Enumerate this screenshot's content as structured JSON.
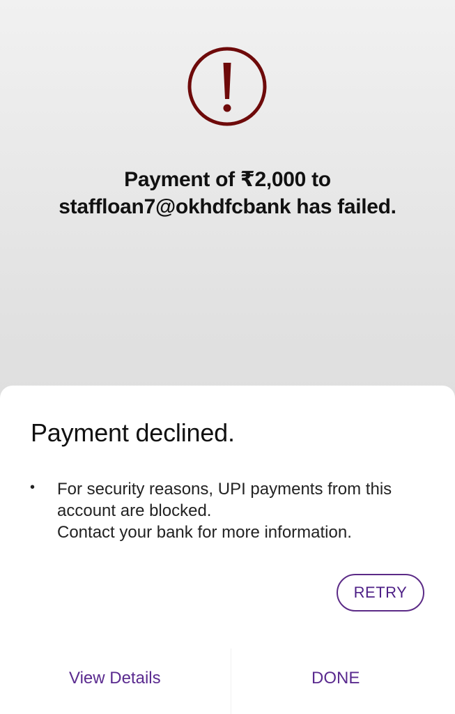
{
  "status": {
    "icon": "exclamation-circle-icon",
    "icon_color": "#6e0a0a",
    "message_line1": "Payment of ₹2,000 to",
    "message_line2": "staffloan7@okhdfcbank has failed."
  },
  "dialog": {
    "title": "Payment declined.",
    "reason_line1": "For security reasons, UPI payments from this",
    "reason_line2": "account are blocked.",
    "reason_line3": "Contact your bank for more information.",
    "retry_label": "RETRY",
    "view_details_label": "View Details",
    "done_label": "DONE",
    "accent_color": "#5a2a8f"
  }
}
